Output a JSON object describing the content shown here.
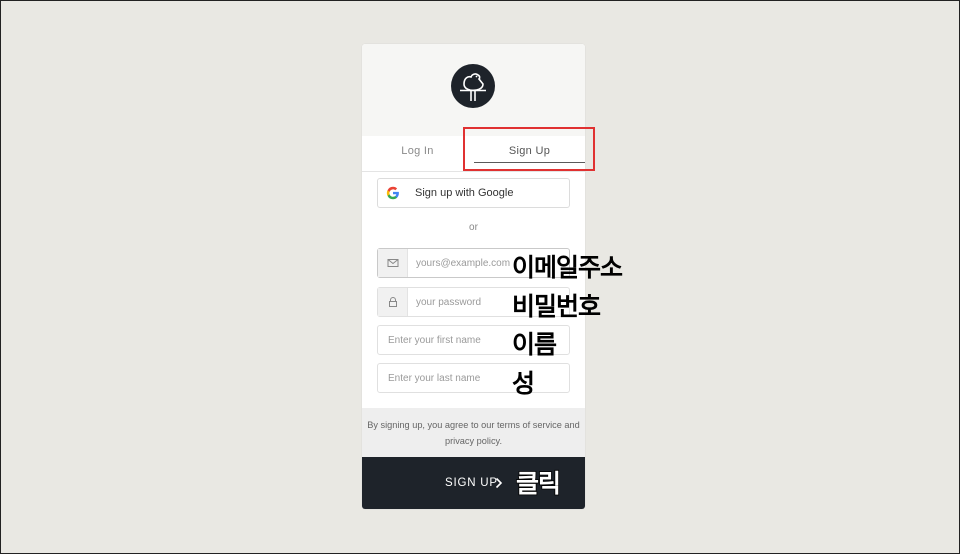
{
  "tabs": {
    "login": "Log In",
    "signup": "Sign Up"
  },
  "google": {
    "label": "Sign up with Google",
    "icon": "google-icon"
  },
  "or_text": "or",
  "fields": {
    "email": {
      "value": "",
      "placeholder": "yours@example.com",
      "icon": "envelope-icon"
    },
    "password": {
      "value": "",
      "placeholder": "your password",
      "icon": "lock-icon"
    },
    "first_name": {
      "value": "",
      "placeholder": "Enter your first name"
    },
    "last_name": {
      "value": "",
      "placeholder": "Enter your last name"
    }
  },
  "terms": {
    "line1": "By signing up, you agree to our terms of service and",
    "line2": "privacy policy."
  },
  "submit": {
    "label": "SIGN UP",
    "icon": "chevron-right-icon"
  },
  "annotations": {
    "email": "이메일주소",
    "password": "비밀번호",
    "first_name": "이름",
    "last_name": "성",
    "click": "클릭"
  },
  "colors": {
    "background": "#e9e8e3",
    "dark": "#1e232a",
    "highlight": "#e03131"
  }
}
